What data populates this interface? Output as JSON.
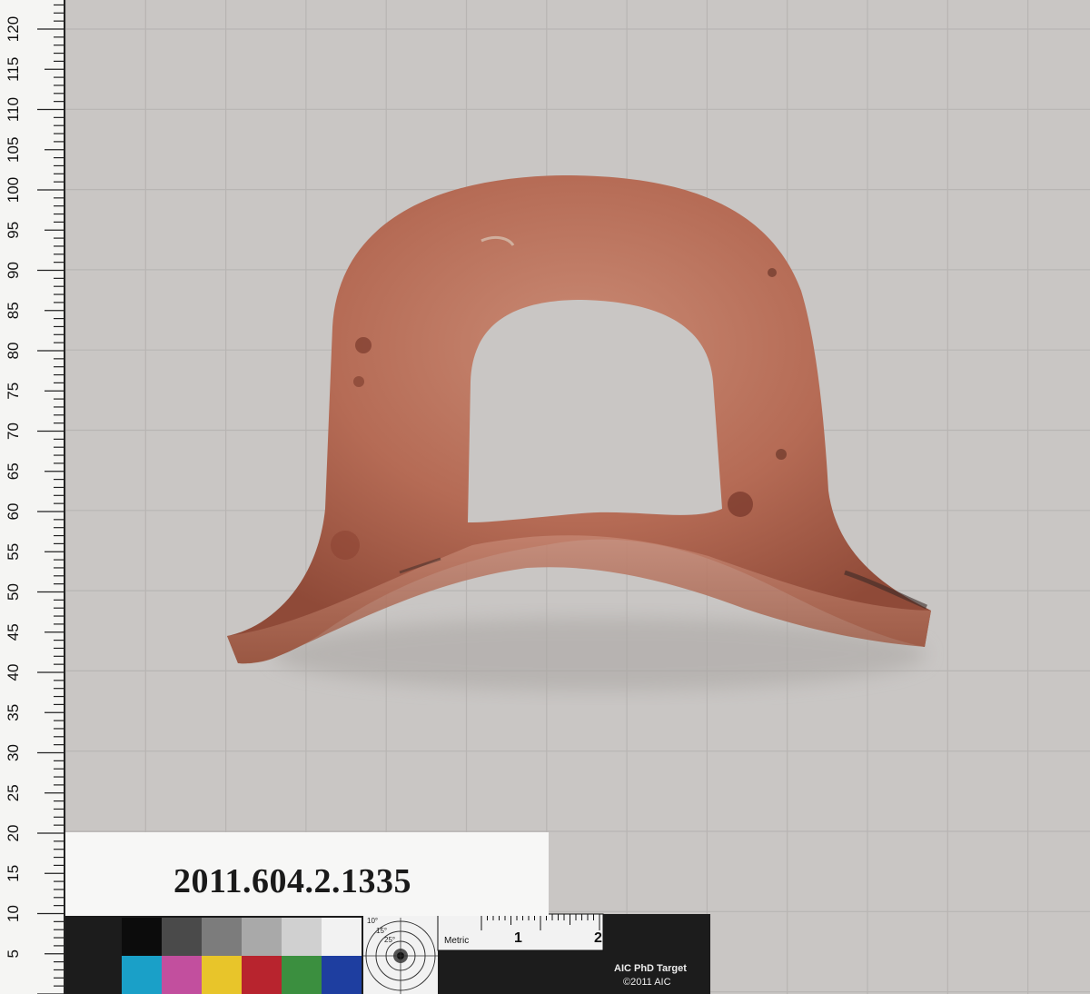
{
  "accession_number": "2011.604.2.1335",
  "ruler": {
    "unit_labels": [
      "120",
      "115",
      "110",
      "105",
      "100",
      "95",
      "90",
      "85",
      "80",
      "75",
      "70",
      "65",
      "60",
      "55",
      "50",
      "45",
      "40",
      "35",
      "30",
      "25",
      "20",
      "15",
      "10",
      "5"
    ]
  },
  "color_target": {
    "metric_label": "Metric",
    "metric_ticks": [
      "1",
      "2"
    ],
    "target_rings": [
      "10°",
      "15°",
      "25°"
    ],
    "brand_line1": "AIC PhD Target",
    "brand_line2": "©2011 AIC",
    "gray_patches": [
      "#0c0c0c",
      "#4a4a4a",
      "#7c7c7c",
      "#a9a9a9",
      "#d0d0d0",
      "#f2f2f2"
    ],
    "color_patches": [
      "#1aa0c8",
      "#c24f9e",
      "#e8c52a",
      "#b8242e",
      "#3b8f3f",
      "#1e3ea0"
    ]
  },
  "colors": {
    "background": "#c9c6c4",
    "grid": "#b8b5b3",
    "terracotta": "#b56b55",
    "terracotta_dark": "#8f4a38"
  }
}
